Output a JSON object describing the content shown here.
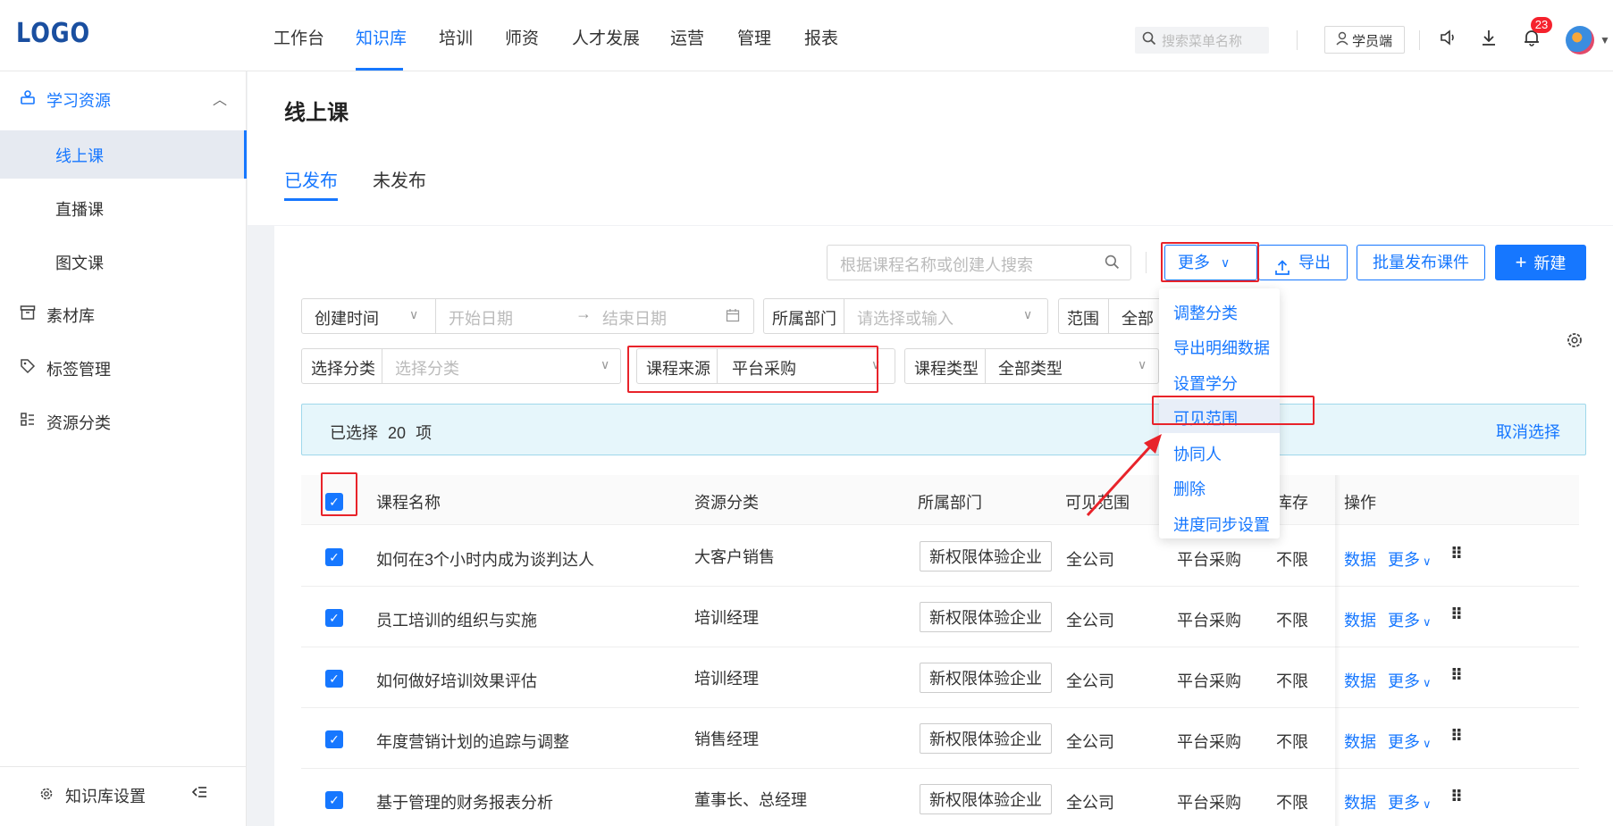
{
  "header": {
    "logo": "LOGO",
    "nav": [
      "工作台",
      "知识库",
      "培训",
      "师资",
      "人才发展",
      "运营",
      "管理",
      "报表"
    ],
    "search_placeholder": "搜索菜单名称",
    "student_btn": "学员端",
    "badge_count": "23"
  },
  "sidebar": {
    "group": "学习资源",
    "sub_items": [
      "线上课",
      "直播课",
      "图文课"
    ],
    "items": [
      "素材库",
      "标签管理",
      "资源分类"
    ],
    "footer": "知识库设置"
  },
  "page": {
    "title": "线上课",
    "tabs": [
      "已发布",
      "未发布"
    ]
  },
  "toolbar": {
    "search_placeholder": "根据课程名称或创建人搜索",
    "more_label": "更多",
    "export_label": "导出",
    "batch_label": "批量发布课件",
    "new_label": "新建"
  },
  "filters": {
    "created_time": "创建时间",
    "start_date": "开始日期",
    "end_date": "结束日期",
    "dept_label": "所属部门",
    "dept_placeholder": "请选择或输入",
    "range_label": "范围",
    "range_value": "全部",
    "category_label": "选择分类",
    "category_placeholder": "选择分类",
    "source_label": "课程来源",
    "source_value": "平台采购",
    "type_label": "课程类型",
    "type_value": "全部类型"
  },
  "selection": {
    "text_prefix": "已选择",
    "count": "20",
    "text_suffix": "项",
    "cancel": "取消选择"
  },
  "dropdown": [
    "调整分类",
    "导出明细数据",
    "设置学分",
    "可见范围",
    "协同人",
    "删除",
    "进度同步设置"
  ],
  "table": {
    "headers": [
      "课程名称",
      "资源分类",
      "所属部门",
      "可见范围",
      "库存",
      "操作"
    ],
    "rows": [
      {
        "name": "如何在3个小时内成为谈判达人",
        "category": "大客户销售",
        "dept": "新权限体验企业",
        "scope": "全公司",
        "source": "平台采购",
        "stock": "不限"
      },
      {
        "name": "员工培训的组织与实施",
        "category": "培训经理",
        "dept": "新权限体验企业",
        "scope": "全公司",
        "source": "平台采购",
        "stock": "不限"
      },
      {
        "name": "如何做好培训效果评估",
        "category": "培训经理",
        "dept": "新权限体验企业",
        "scope": "全公司",
        "source": "平台采购",
        "stock": "不限"
      },
      {
        "name": "年度营销计划的追踪与调整",
        "category": "销售经理",
        "dept": "新权限体验企业",
        "scope": "全公司",
        "source": "平台采购",
        "stock": "不限"
      },
      {
        "name": "基于管理的财务报表分析",
        "category": "董事长、总经理",
        "dept": "新权限体验企业",
        "scope": "全公司",
        "source": "平台采购",
        "stock": "不限"
      }
    ],
    "op_data": "数据",
    "op_more": "更多"
  }
}
